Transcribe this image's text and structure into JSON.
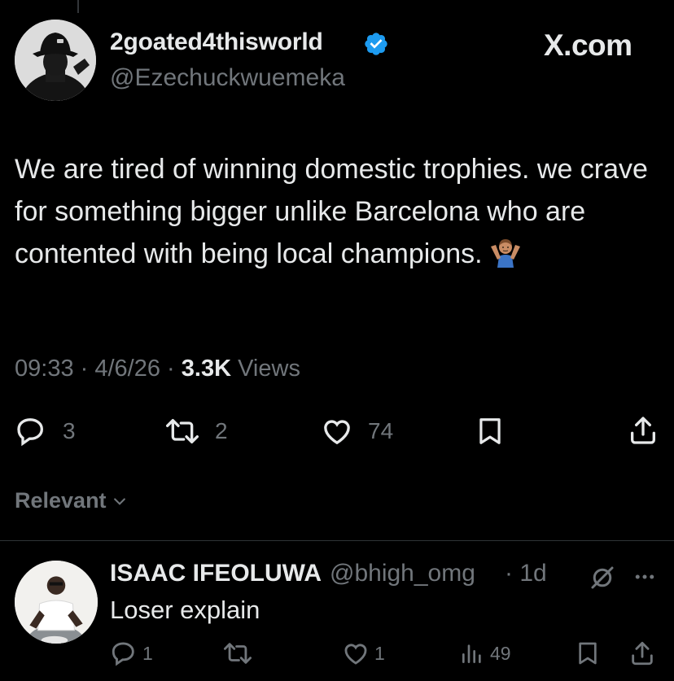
{
  "tweet": {
    "author_name": "2goated4thisworld",
    "author_handle": "@Ezechuckwuemeka",
    "brand": "X.com",
    "text": "We are tired of winning domestic trophies. we crave for something bigger unlike Barcelona who are contented with being local champions.",
    "emoji": "person-shrugging-emoji",
    "time": "09:33",
    "date": "4/6/26",
    "separator": " · ",
    "views_count": "3.3K",
    "views_label": "Views",
    "replies": "3",
    "reposts": "2",
    "likes": "74"
  },
  "sort": {
    "label": "Relevant"
  },
  "reply": {
    "author_name": "ISAAC IFEOLUWA",
    "author_handle": "@bhigh_omg",
    "age": "· 1d",
    "text": "Loser explain",
    "replies": "1",
    "likes": "1",
    "views": "49"
  },
  "colors": {
    "background": "#000000",
    "text": "#e7e9ea",
    "muted": "#71767b",
    "verified": "#1d9bf0",
    "divider": "#2f3336"
  },
  "icons": [
    "verified-badge-icon",
    "reply-icon",
    "repost-icon",
    "like-icon",
    "bookmark-icon",
    "share-icon",
    "chevron-down-icon",
    "grok-icon",
    "more-icon",
    "views-icon"
  ]
}
